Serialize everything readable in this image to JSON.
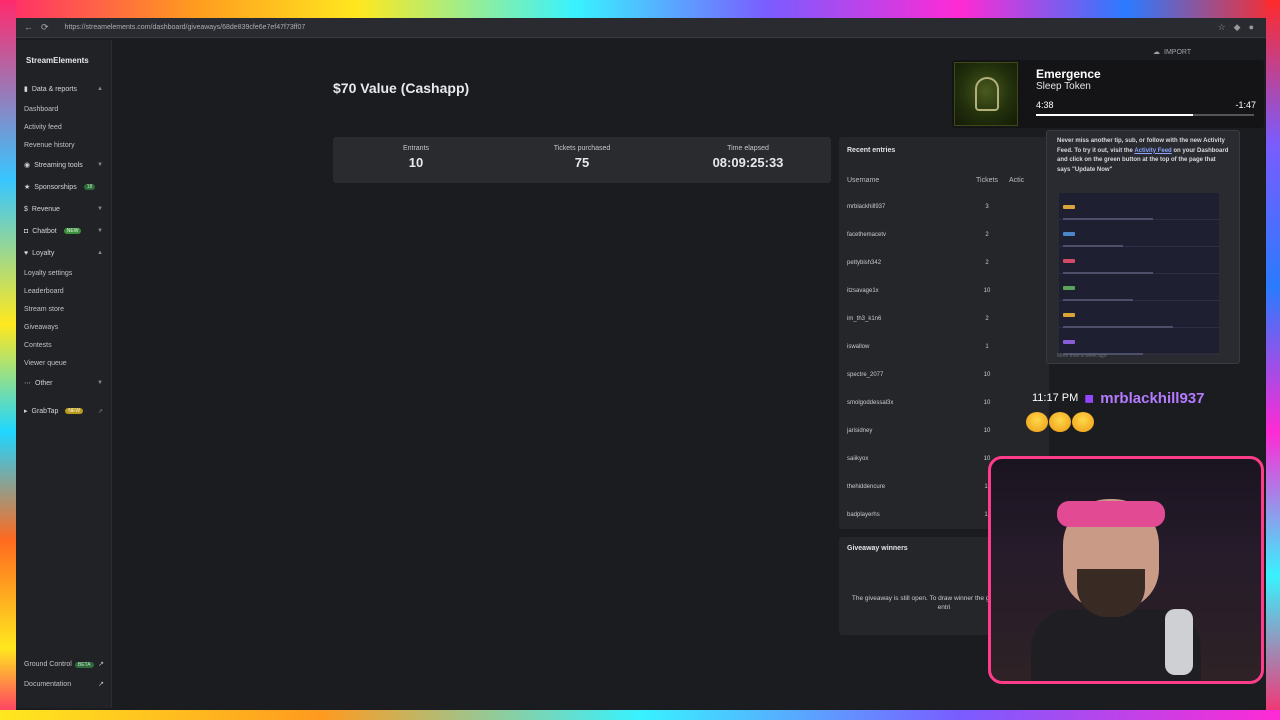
{
  "browser": {
    "url": "https://streamelements.com/dashboard/giveaways/68de839cfe6e7ef47f73ff07"
  },
  "sidebar": {
    "brand": "StreamElements",
    "groups": [
      {
        "label": "Data & reports",
        "icon": "chart-icon"
      },
      {
        "label": "Streaming tools",
        "icon": "broadcast-icon"
      },
      {
        "label": "Sponsorships",
        "icon": "star-icon",
        "badge": "18"
      },
      {
        "label": "Revenue",
        "icon": "dollar-icon"
      },
      {
        "label": "Chatbot",
        "icon": "bot-icon",
        "badge": "NEW"
      },
      {
        "label": "Loyalty",
        "icon": "heart-icon"
      },
      {
        "label": "Other",
        "icon": "dots-icon"
      },
      {
        "label": "GrabTap",
        "icon": "grab-icon",
        "badge": "NEW"
      }
    ],
    "data_items": [
      "Dashboard",
      "Activity feed",
      "Revenue history"
    ],
    "loyalty_items": [
      "Loyalty settings",
      "Leaderboard",
      "Stream store",
      "Giveaways",
      "Contests",
      "Viewer queue"
    ],
    "bottom": [
      {
        "label": "Ground Control",
        "badge": "BETA"
      },
      {
        "label": "Documentation"
      }
    ]
  },
  "header": {
    "import_label": "IMPORT"
  },
  "giveaway": {
    "title": "$70 Value (Cashapp)",
    "stats": {
      "entrants_label": "Entrants",
      "entrants": "10",
      "tickets_label": "Tickets purchased",
      "tickets": "75",
      "elapsed_label": "Time elapsed",
      "elapsed": "08:09:25:33"
    },
    "recent_entries": {
      "title": "Recent entries",
      "col_username": "Username",
      "col_tickets": "Tickets",
      "col_actions": "Actic",
      "rows": [
        {
          "user": "mrblackhill937",
          "tickets": "3"
        },
        {
          "user": "facethemacetv",
          "tickets": "2"
        },
        {
          "user": "pettybish342",
          "tickets": "2"
        },
        {
          "user": "itzsavage1x",
          "tickets": "10"
        },
        {
          "user": "im_th3_k1n6",
          "tickets": "2"
        },
        {
          "user": "iswallow",
          "tickets": "1"
        },
        {
          "user": "spectre_2077",
          "tickets": "10"
        },
        {
          "user": "smolgoddessal3x",
          "tickets": "10"
        },
        {
          "user": "jarisidney",
          "tickets": "10"
        },
        {
          "user": "saiikyox",
          "tickets": "10"
        },
        {
          "user": "thehiddencure",
          "tickets": "1("
        },
        {
          "user": "badplayerhs",
          "tickets": "1("
        }
      ]
    },
    "winners": {
      "title": "Giveaway winners",
      "text": "The giveaway is still open. To draw winner the giveaway for new entri"
    }
  },
  "now_playing": {
    "title": "Emergence",
    "artist": "Sleep Token",
    "elapsed": "4:38",
    "remaining": "-1:47",
    "progress": 0.72
  },
  "activity_popup": {
    "text_a": "Never miss another tip, sub, or follow with the new Activity Feed. To try it out, visit the",
    "link": "Activity Feed",
    "text_b": "on your Dashboard and click on the green button at the top of the page that says \"Update Now\"",
    "footer": "More than a week ago"
  },
  "chat": {
    "time": "11:17 PM",
    "username": "mrblackhill937"
  },
  "colors": {
    "accent": "#b57bff",
    "webcam_border": "#ff3c8a"
  }
}
